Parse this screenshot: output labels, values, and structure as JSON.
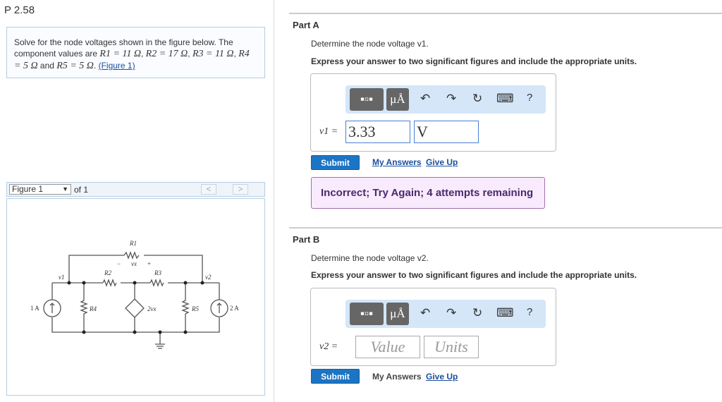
{
  "problem": {
    "title": "P 2.58",
    "text1": "Solve for the node voltages shown in the figure below. The component values are ",
    "r1": "R1 = 11 Ω",
    "r2": "R2 = 17 Ω",
    "r3": "R3 = 11 Ω",
    "r4": "R4 = 5 Ω",
    "and": " and ",
    "r5": "R5 = 5 Ω",
    "figure_link": "(Figure 1)"
  },
  "figure": {
    "selector": "Figure 1",
    "of": "of 1",
    "prev": "<",
    "next": ">",
    "labels": {
      "R1": "R1",
      "R2": "R2",
      "R3": "R3",
      "R4": "R4",
      "R5": "R5",
      "v1": "v1",
      "v2": "v2",
      "vx": "vx",
      "minus": "−",
      "plus": "+",
      "src1": "1 A",
      "src2": "2 A",
      "dep": "2vx"
    }
  },
  "toolbar": {
    "templates": "templates",
    "units": "μÅ",
    "undo": "↶",
    "redo": "↷",
    "reset": "↻",
    "keyboard": "⌨",
    "help": "?"
  },
  "partA": {
    "label": "Part A",
    "question": "Determine the node voltage v1.",
    "instruction": "Express your answer to two significant figures and include the appropriate units.",
    "var": "v1 =",
    "value": "3.33",
    "units": "V",
    "submit": "Submit",
    "my_answers": "My Answers",
    "give_up": "Give Up",
    "feedback": "Incorrect; Try Again; 4 attempts remaining"
  },
  "partB": {
    "label": "Part B",
    "question": "Determine the node voltage v2.",
    "instruction": "Express your answer to two significant figures and include the appropriate units.",
    "var": "v2 =",
    "value_placeholder": "Value",
    "units_placeholder": "Units",
    "submit": "Submit",
    "my_answers": "My Answers",
    "give_up": "Give Up"
  }
}
